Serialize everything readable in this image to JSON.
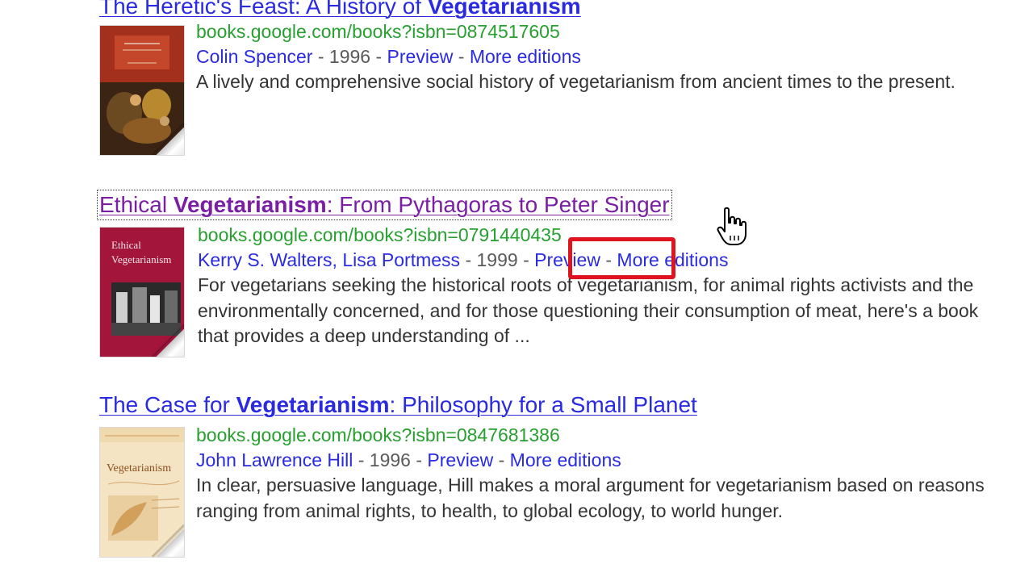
{
  "colors": {
    "link": "#2a2ae0",
    "visited": "#7a1fa3",
    "url": "#27a02f",
    "meta": "#5a5a5a",
    "highlight": "#e0141e"
  },
  "results": [
    {
      "title_pre": "The Heretic's Feast: A History of ",
      "title_bold": "Vegetarianism",
      "title_post": "",
      "url": "books.google.com/books?isbn=0874517605",
      "author": "Colin Spencer",
      "year": "1996",
      "preview": "Preview",
      "more": "More editions",
      "snippet": "A lively and comprehensive social history of vegetarianism from ancient times to the present.",
      "cover_icon": "book-cover-painting"
    },
    {
      "title_pre": "Ethical ",
      "title_bold": "Vegetarianism",
      "title_post": ": From Pythagoras to Peter Singer",
      "url": "books.google.com/books?isbn=0791440435",
      "author": "Kerry S. Walters, Lisa Portmess",
      "year": "1999",
      "preview": "Preview",
      "more": "More editions",
      "snippet": "For vegetarians seeking the historical roots of vegetarianism, for animal rights activists and the environmentally concerned, and for those questioning their consumption of meat, here's a book that provides a deep understanding of ...",
      "cover_title": "Ethical Vegetarianism",
      "cover_icon": "book-cover-red"
    },
    {
      "title_pre": "The Case for ",
      "title_bold": "Vegetarianism",
      "title_post": ": Philosophy for a Small Planet",
      "url": "books.google.com/books?isbn=0847681386",
      "author": "John Lawrence Hill",
      "year": "1996",
      "preview": "Preview",
      "more": "More editions",
      "snippet": "In clear, persuasive language, Hill makes a moral argument for vegetarianism based on reasons ranging from animal rights, to health, to global ecology, to world hunger.",
      "cover_title": "Vegetarianism",
      "cover_icon": "book-cover-cream"
    }
  ],
  "separator": "-"
}
